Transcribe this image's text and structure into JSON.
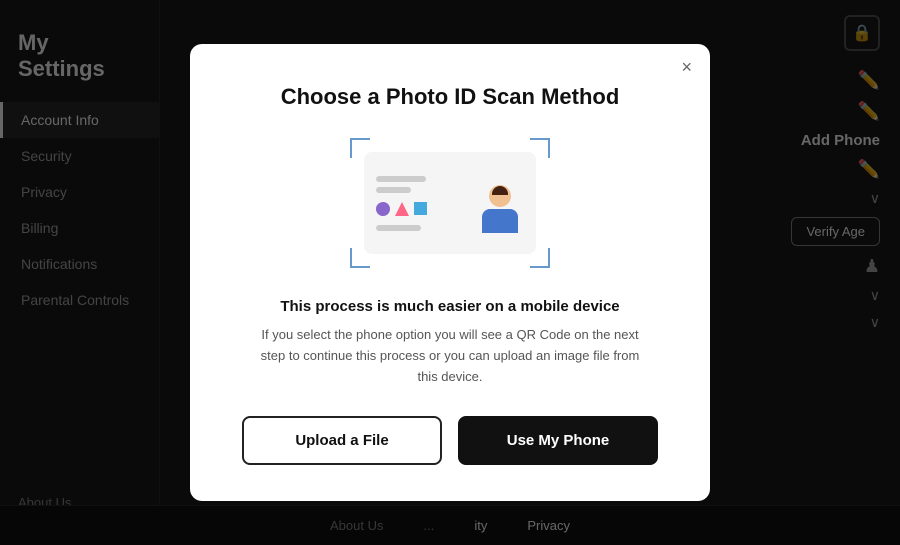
{
  "app": {
    "title": "My Settings"
  },
  "sidebar": {
    "items": [
      {
        "id": "account-info",
        "label": "Account Info",
        "active": true
      },
      {
        "id": "security",
        "label": "Security",
        "active": false
      },
      {
        "id": "privacy",
        "label": "Privacy",
        "active": false
      },
      {
        "id": "billing",
        "label": "Billing",
        "active": false
      },
      {
        "id": "notifications",
        "label": "Notifications",
        "active": false
      },
      {
        "id": "parental-controls",
        "label": "Parental Controls",
        "active": false
      }
    ]
  },
  "sidebar_footer": {
    "label": "About Us"
  },
  "right_panel": {
    "add_phone": "Add Phone",
    "verify_age": "Verify Age"
  },
  "modal": {
    "title": "Choose a Photo ID Scan Method",
    "hint_bold": "This process is much easier on a mobile device",
    "hint_text": "If you select the phone option you will see a QR Code on the next step to continue this process or you can upload an image file from this device.",
    "btn_upload": "Upload a File",
    "btn_phone": "Use My Phone",
    "close_label": "×"
  },
  "footer": {
    "links": [
      "About Us",
      "...",
      "ity",
      "Privacy"
    ]
  }
}
